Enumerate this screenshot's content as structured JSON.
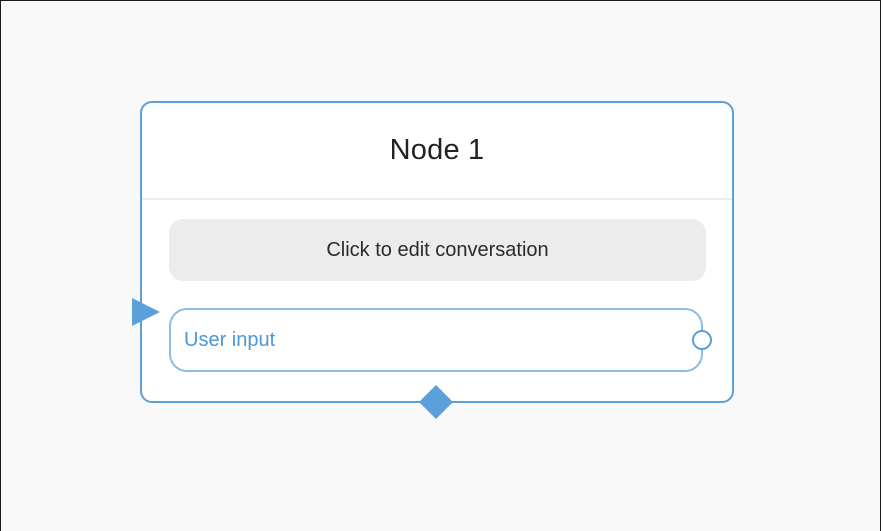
{
  "node": {
    "title": "Node 1",
    "edit_conversation_label": "Click to edit conversation",
    "user_input_label": "User input"
  },
  "ports": {
    "input_icon": "triangle-right",
    "output_icon": "circle-outline",
    "bottom_icon": "diamond"
  },
  "colors": {
    "accent": "#5b9fdb",
    "canvas_background": "#f9f9f9",
    "conversation_button": "#ececec",
    "user_input_text": "#4c97d8"
  }
}
